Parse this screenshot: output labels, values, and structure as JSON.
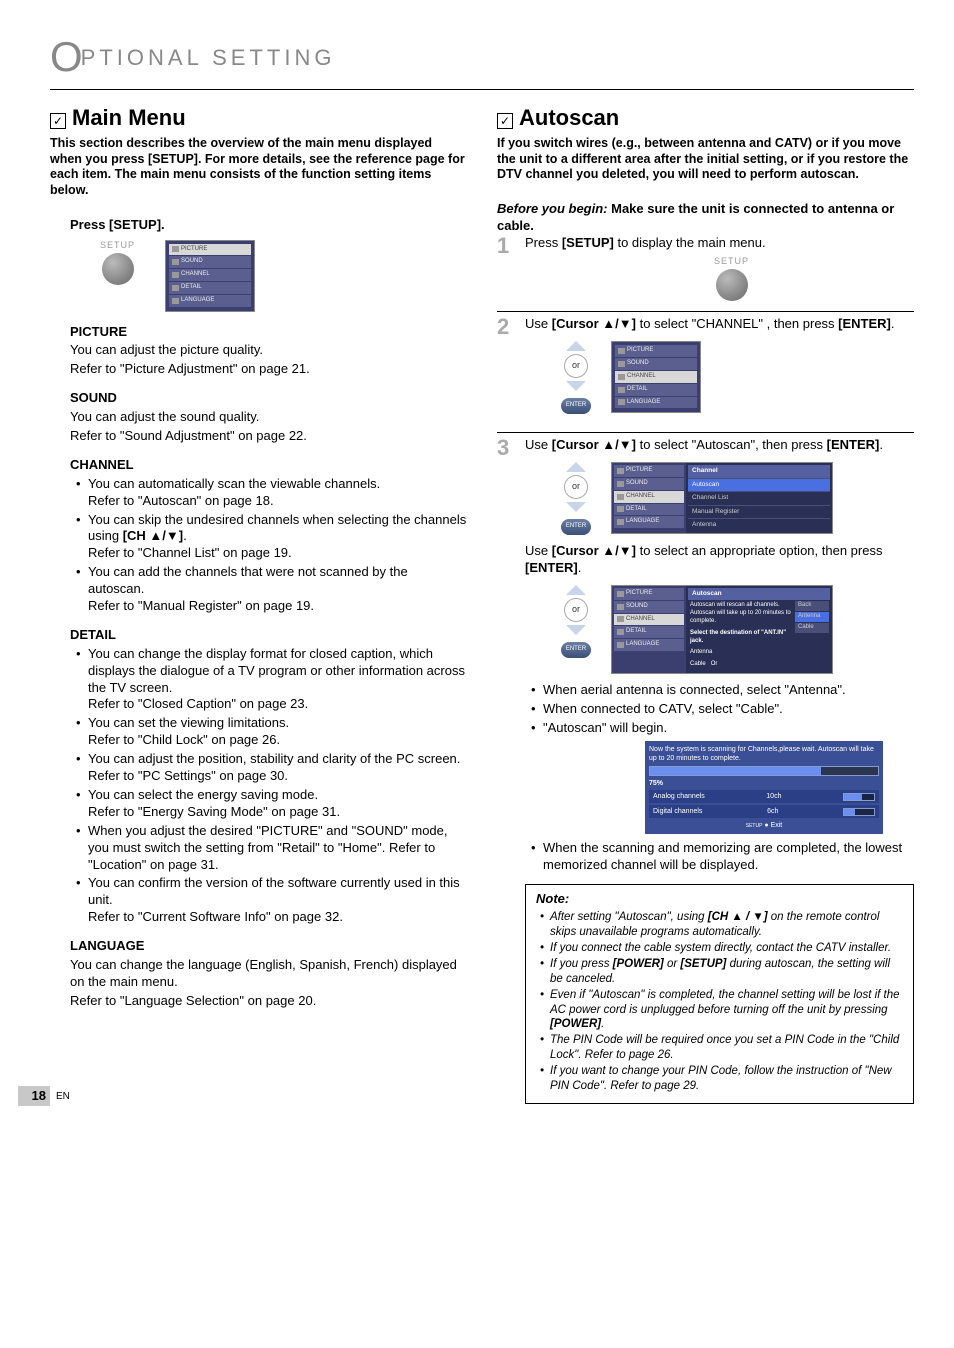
{
  "header": {
    "title_prefix": "O",
    "title_rest": "PTIONAL  SETTING"
  },
  "page_number": "18",
  "page_lang": "EN",
  "left": {
    "title": "Main Menu",
    "intro": "This section describes the overview of the main menu displayed when you press [SETUP]. For more details, see the reference page for each item. The main menu consists of the function setting items below.",
    "press_setup": "Press [SETUP].",
    "setup_label": "SETUP",
    "menu": [
      "PICTURE",
      "SOUND",
      "CHANNEL",
      "DETAIL",
      "LANGUAGE"
    ],
    "sections": {
      "picture": {
        "head": "PICTURE",
        "l1": "You can adjust the picture quality.",
        "l2": "Refer to \"Picture Adjustment\" on page 21."
      },
      "sound": {
        "head": "SOUND",
        "l1": "You can adjust the sound quality.",
        "l2": "Refer to \"Sound Adjustment\" on page 22."
      },
      "channel": {
        "head": "CHANNEL",
        "b1a": "You can automatically scan the viewable channels.",
        "b1b": "Refer to \"Autoscan\" on page 18.",
        "b2a": "You can skip the undesired channels when selecting the channels using [CH ▲/▼].",
        "b2b": "Refer to \"Channel List\" on page 19.",
        "b3a": "You can add the channels that were not scanned by the autoscan.",
        "b3b": "Refer to \"Manual Register\" on page 19."
      },
      "detail": {
        "head": "DETAIL",
        "b1a": "You can change the display format for closed caption, which displays the dialogue of a TV program or other information across the TV screen.",
        "b1b": "Refer to \"Closed Caption\" on page 23.",
        "b2a": "You can set the viewing limitations.",
        "b2b": "Refer to \"Child Lock\" on page 26.",
        "b3a": "You can adjust the position, stability and clarity of the PC screen.",
        "b3b": "Refer to \"PC Settings\" on page 30.",
        "b4a": "You can select the energy saving mode.",
        "b4b": "Refer to \"Energy Saving Mode\" on page 31.",
        "b5a": "When you adjust the desired \"PICTURE\" and \"SOUND\" mode, you must switch the setting from \"Retail\" to \"Home\". Refer to \"Location\" on page 31.",
        "b6a": "You can confirm the version of the software currently used in this unit.",
        "b6b": "Refer to \"Current Software Info\" on page 32."
      },
      "language": {
        "head": "LANGUAGE",
        "l1": "You can change the language (English, Spanish, French) displayed on the main menu.",
        "l2": "Refer to \"Language Selection\" on page 20."
      }
    }
  },
  "right": {
    "title": "Autoscan",
    "intro": "If you switch wires (e.g., between antenna and CATV) or if you move the unit to a different area after the initial setting, or if you restore the DTV channel you deleted, you will need to perform autoscan.",
    "before_label": "Before you begin:",
    "before_text": " Make sure the unit is connected to antenna or cable.",
    "steps": {
      "s1": {
        "num": "1",
        "text_a": "Press ",
        "text_b": "[SETUP]",
        "text_c": " to display the main menu.",
        "setup_label": "SETUP"
      },
      "s2": {
        "num": "2",
        "text_a": "Use ",
        "text_b": "[Cursor ▲/▼]",
        "text_c": " to select \"CHANNEL\" , then press ",
        "text_d": "[ENTER]",
        "text_e": ".",
        "or": "or",
        "enter": "ENTER"
      },
      "s3": {
        "num": "3",
        "line1_a": "Use ",
        "line1_b": "[Cursor ▲/▼]",
        "line1_c": " to select \"Autoscan\", then press ",
        "line1_d": "[ENTER]",
        "line1_e": ".",
        "line2_a": "Use ",
        "line2_b": "[Cursor ▲/▼]",
        "line2_c": " to select an appropriate option, then press ",
        "line2_d": "[ENTER]",
        "line2_e": ".",
        "or": "or",
        "enter": "ENTER",
        "submenu_title": "Channel",
        "submenu_items": [
          "Autoscan",
          "Channel List",
          "Manual Register",
          "Antenna"
        ],
        "autoscan_title": "Autoscan",
        "autoscan_msg": "Autoscan will rescan all channels. Autoscan will take up to 20 minutes to complete.",
        "autoscan_sel": "Select the destination of \"ANT.IN\" jack.",
        "autoscan_antenna": "Antenna",
        "autoscan_cable": "Cable",
        "side_back": "Back",
        "side_antenna": "Antenna",
        "side_cable": "Cable",
        "or_label": "Or",
        "bullets": {
          "b1": "When aerial antenna is connected, select \"Antenna\".",
          "b2": "When connected to CATV, select \"Cable\".",
          "b3": "\"Autoscan\" will begin.",
          "b4": "When the scanning and memorizing are completed, the lowest memorized channel will be displayed."
        },
        "progress": {
          "msg": "Now the system is scanning for Channels,please wait. Autoscan will take up to 20 minutes to complete.",
          "pct": "75%",
          "analog_label": "Analog channels",
          "analog_val": "10ch",
          "digital_label": "Digital channels",
          "digital_val": "6ch",
          "exit": "Exit",
          "setup": "SETUP"
        }
      }
    },
    "note": {
      "head": "Note:",
      "n1": "After setting \"Autoscan\", using [CH ▲ / ▼] on the remote control skips unavailable programs automatically.",
      "n2": "If you connect the cable system directly, contact the CATV installer.",
      "n3": "If you press [POWER] or [SETUP] during autoscan, the setting will be canceled.",
      "n4": "Even if \"Autoscan\" is completed, the channel setting will be lost if the AC power cord is unplugged before turning off the unit by pressing [POWER].",
      "n5": "The PIN Code will be required once you set a PIN Code in the \"Child Lock\". Refer to page 26.",
      "n6": "If you want to change your PIN Code, follow the instruction of \"New PIN Code\". Refer to page 29."
    }
  }
}
